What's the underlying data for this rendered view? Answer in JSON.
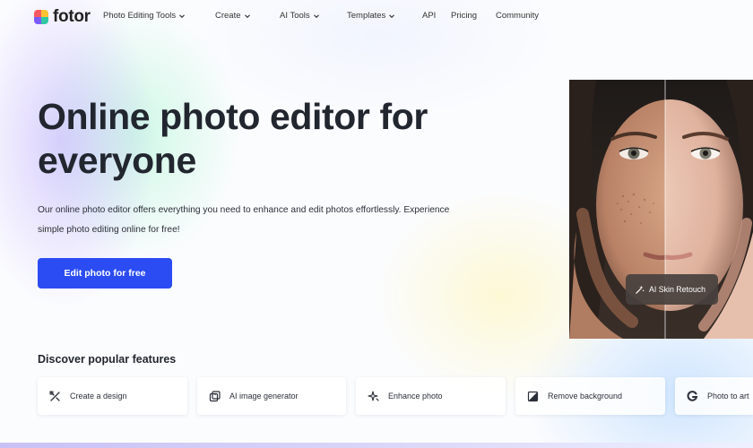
{
  "brand": {
    "name": "fotor"
  },
  "nav": {
    "items": [
      {
        "label": "Photo Editing Tools",
        "has_dropdown": true
      },
      {
        "label": "Create",
        "has_dropdown": true
      },
      {
        "label": "AI Tools",
        "has_dropdown": true
      },
      {
        "label": "Templates",
        "has_dropdown": true
      },
      {
        "label": "API",
        "has_dropdown": false
      },
      {
        "label": "Pricing",
        "has_dropdown": false
      },
      {
        "label": "Community",
        "has_dropdown": false
      }
    ]
  },
  "hero": {
    "title_line1": "Online photo editor for",
    "title_line2": "everyone",
    "description_line1": "Our online photo editor offers everything you need to enhance and edit photos effortlessly. Experience",
    "description_line2": "simple photo editing online for free!",
    "cta_label": "Edit photo for free"
  },
  "preview": {
    "badge_label": "AI Skin Retouch",
    "badge_icon": "sparkle-wand-icon"
  },
  "features": {
    "title": "Discover popular features",
    "items": [
      {
        "label": "Create a design",
        "icon": "design-tools-icon"
      },
      {
        "label": "AI image generator",
        "icon": "ai-image-icon"
      },
      {
        "label": "Enhance photo",
        "icon": "sparkle-enhance-icon"
      },
      {
        "label": "Remove background",
        "icon": "remove-bg-icon"
      },
      {
        "label": "Photo to art",
        "icon": "g-logo-icon"
      }
    ]
  },
  "colors": {
    "accent": "#2b4cf2",
    "text": "#22262f",
    "badge_bg": "#46403e"
  }
}
